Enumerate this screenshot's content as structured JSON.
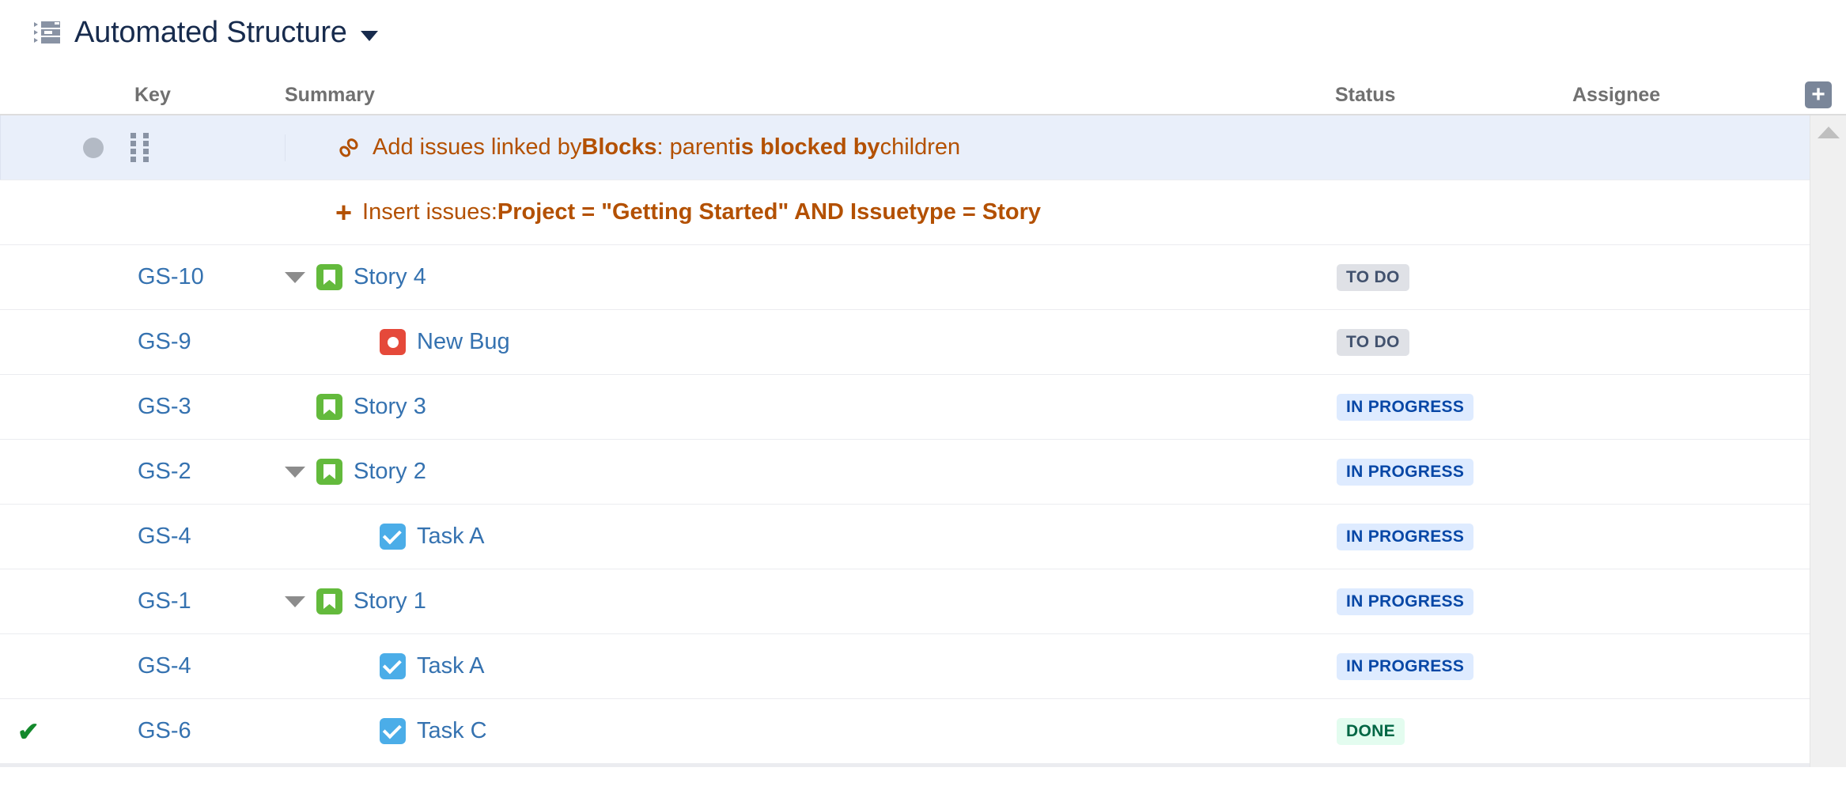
{
  "header": {
    "title": "Automated Structure",
    "structure_icon": "structure-list-icon",
    "caret_icon": "chevron-down-icon"
  },
  "columns": {
    "key": "Key",
    "summary": "Summary",
    "status": "Status",
    "assignee": "Assignee",
    "add_column_label": "+",
    "add_column_icon": "plus-icon"
  },
  "colors": {
    "generator_text": "#B35000",
    "link_blue": "#3572B0",
    "story_green": "#63BA3C",
    "bug_red": "#E5493A",
    "task_blue": "#4BADE8",
    "selected_row": "#E9EFFA",
    "todo_bg": "#DFE1E6",
    "todo_fg": "#42526E",
    "inprogress_bg": "#DEEBFF",
    "inprogress_fg": "#0747A6",
    "done_bg": "#E3FCEF",
    "done_fg": "#006644",
    "done_check": "#14892C"
  },
  "generators": [
    {
      "icon": "link-chain-icon",
      "selected": true,
      "parts": [
        {
          "text": "Add issues linked by ",
          "bold": false
        },
        {
          "text": "Blocks",
          "bold": true
        },
        {
          "text": ": parent ",
          "bold": false
        },
        {
          "text": "is blocked by",
          "bold": true
        },
        {
          "text": " children",
          "bold": false
        }
      ]
    },
    {
      "icon": "plus-icon",
      "selected": false,
      "parts": [
        {
          "text": "Insert issues: ",
          "bold": false
        },
        {
          "text": "Project = \"Getting Started\" AND Issuetype = Story",
          "bold": true
        }
      ]
    }
  ],
  "rows": [
    {
      "key": "GS-10",
      "summary": "Story 4",
      "type": "story",
      "type_icon": "story-icon",
      "indent": 0,
      "expander": true,
      "status": "TO DO",
      "status_class": "todo",
      "assignee": "",
      "done_mark": false
    },
    {
      "key": "GS-9",
      "summary": "New Bug",
      "type": "bug",
      "type_icon": "bug-icon",
      "indent": 1,
      "expander": false,
      "status": "TO DO",
      "status_class": "todo",
      "assignee": "",
      "done_mark": false
    },
    {
      "key": "GS-3",
      "summary": "Story 3",
      "type": "story",
      "type_icon": "story-icon",
      "indent": 0,
      "expander": false,
      "status": "IN PROGRESS",
      "status_class": "inprogress",
      "assignee": "",
      "done_mark": false
    },
    {
      "key": "GS-2",
      "summary": "Story 2",
      "type": "story",
      "type_icon": "story-icon",
      "indent": 0,
      "expander": true,
      "status": "IN PROGRESS",
      "status_class": "inprogress",
      "assignee": "",
      "done_mark": false
    },
    {
      "key": "GS-4",
      "summary": "Task A",
      "type": "task",
      "type_icon": "task-icon",
      "indent": 1,
      "expander": false,
      "status": "IN PROGRESS",
      "status_class": "inprogress",
      "assignee": "",
      "done_mark": false
    },
    {
      "key": "GS-1",
      "summary": "Story 1",
      "type": "story",
      "type_icon": "story-icon",
      "indent": 0,
      "expander": true,
      "status": "IN PROGRESS",
      "status_class": "inprogress",
      "assignee": "",
      "done_mark": false
    },
    {
      "key": "GS-4",
      "summary": "Task A",
      "type": "task",
      "type_icon": "task-icon",
      "indent": 1,
      "expander": false,
      "status": "IN PROGRESS",
      "status_class": "inprogress",
      "assignee": "",
      "done_mark": false
    },
    {
      "key": "GS-6",
      "summary": "Task C",
      "type": "task",
      "type_icon": "task-icon",
      "indent": 1,
      "expander": false,
      "status": "DONE",
      "status_class": "done",
      "assignee": "",
      "done_mark": true
    }
  ],
  "scrollbar": {
    "up_arrow_icon": "chevron-up-icon"
  }
}
